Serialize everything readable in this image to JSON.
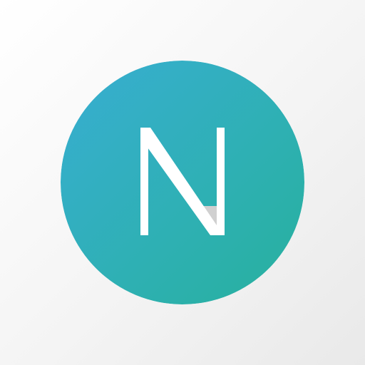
{
  "app_icon": {
    "icon": "letter-n-circle-icon",
    "letter": "N",
    "colors": {
      "page_background_light": "#ffffff",
      "page_background_dark": "#e9e9e9",
      "circle_gradient_start": "#38aed2",
      "circle_gradient_end": "#27b19d",
      "letter_color": "#ffffff",
      "letter_shadow": "#d0d0d0"
    }
  }
}
